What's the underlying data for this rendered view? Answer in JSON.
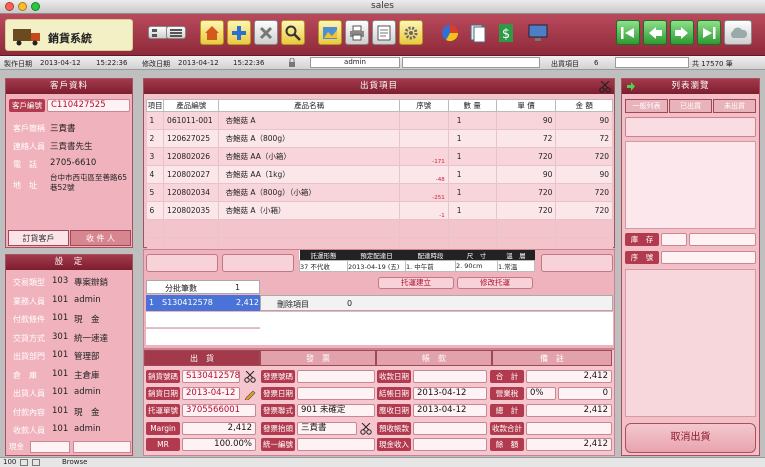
{
  "window": {
    "title": "sales"
  },
  "app": {
    "title": "銷貨系統"
  },
  "status": {
    "made_date_label": "製作日期",
    "made_date": "2013-04-12",
    "made_time": "15:22:36",
    "modified_date_label": "修改日期",
    "modified_date": "2013-04-12",
    "modified_time": "15:22:36",
    "user": "admin",
    "ship_items_label": "出貨項目",
    "ship_items_count": "6",
    "total_label": "共 17570 筆"
  },
  "customer": {
    "header": "客戶資料",
    "code_label": "客戶編號",
    "code": "C110427525",
    "short_label": "客戶簡稱",
    "short": "三貢書",
    "contact_label": "連絡人員",
    "contact": "三貢書先生",
    "phone_label": "電　話",
    "phone": "2705-6610",
    "address_label": "地　址",
    "address": "台中市西屯區至善路65巷52號",
    "tab_order": "訂貨客戶",
    "tab_receive": "收 件 人"
  },
  "settings": {
    "header": "設　定",
    "rows": [
      {
        "label": "交易類型",
        "code": "103",
        "name": "專案辦銷"
      },
      {
        "label": "業務人員",
        "code": "101",
        "name": "admin"
      },
      {
        "label": "付款條件",
        "code": "101",
        "name": "現　金"
      },
      {
        "label": "交貨方式",
        "code": "301",
        "name": "統一速達"
      },
      {
        "label": "出貨部門",
        "code": "101",
        "name": "管理部"
      },
      {
        "label": "倉　庫",
        "code": "101",
        "name": "主倉庫"
      },
      {
        "label": "出貨人員",
        "code": "101",
        "name": "admin"
      },
      {
        "label": "付款內容",
        "code": "101",
        "name": "現　金"
      },
      {
        "label": "收款人員",
        "code": "101",
        "name": "admin"
      }
    ],
    "cash_label": "現金"
  },
  "items": {
    "header": "出貨項目",
    "columns": [
      "項目",
      "產品編號",
      "產品名稱",
      "序號",
      "數 量",
      "單 價",
      "金 額"
    ],
    "rows": [
      {
        "no": "1",
        "code": "061011-001",
        "name": "杏鮑菇 A",
        "serial": "",
        "qty": "1",
        "price": "90",
        "amount": "90"
      },
      {
        "no": "2",
        "code": "120627025",
        "name": "杏鮑菇 A（800g）",
        "serial": "",
        "qty": "1",
        "price": "72",
        "amount": "72"
      },
      {
        "no": "3",
        "code": "120802026",
        "name": "杏鮑菇 AA（小箱）",
        "serial": "-171",
        "qty": "1",
        "price": "720",
        "amount": "720"
      },
      {
        "no": "4",
        "code": "120802027",
        "name": "杏鮑菇 AA（1kg）",
        "serial": "-48",
        "qty": "1",
        "price": "90",
        "amount": "90"
      },
      {
        "no": "5",
        "code": "120802034",
        "name": "杏鮑菇 A（800g）（小箱）",
        "serial": "-251",
        "qty": "1",
        "price": "720",
        "amount": "720"
      },
      {
        "no": "6",
        "code": "120802035",
        "name": "杏鮑菇 A（小箱）",
        "serial": "-1",
        "qty": "1",
        "price": "720",
        "amount": "720"
      }
    ]
  },
  "consign": {
    "columns": [
      "託運形態",
      "預定配達日",
      "配達時段",
      "尺　寸",
      "溫　層"
    ],
    "row": {
      "type": "37 不代收",
      "date": "2013-04-19 (五)",
      "slot": "1. 中午前",
      "size": "2. 90cm",
      "temp": "1.常溫"
    },
    "create_button": "托運建立",
    "modify_button": "修改托運"
  },
  "batch": {
    "count_label": "分批筆數",
    "count": "1",
    "row_no": "1",
    "row_code": "S130412578",
    "row_amount": "2,412",
    "remove_label": "刪除項目",
    "remove_value": "0"
  },
  "bottom": {
    "tabs": [
      "出　貨",
      "發　票",
      "帳　款",
      "備　註"
    ],
    "ship_no_label": "銷貨號碼",
    "ship_no": "S130412578",
    "ship_date_label": "銷貨日期",
    "ship_date": "2013-04-12",
    "consign_no_label": "托運單號",
    "consign_no": "3705566001",
    "margin_label": "Margin",
    "margin": "2,412",
    "mr_label": "MR",
    "mr": "100.00%",
    "inv_no_label": "發票號碼",
    "inv_date_label": "發票日期",
    "inv_type_label": "發票聯式",
    "inv_type": "901 未確定",
    "inv_head_label": "發票抬頭",
    "inv_head": "三貢書",
    "tax_id_label": "統一編號",
    "recv_date_label": "收款日期",
    "close_date_label": "結帳日期",
    "close_date": "2013-04-12",
    "due_date_label": "應收日期",
    "due_date": "2013-04-12",
    "pre_recv_label": "預收帳款",
    "cash_recv_label": "現金收入",
    "subtotal_label": "合　計",
    "subtotal": "2,412",
    "tax_label": "營業稅",
    "tax_rate": "0%",
    "tax": "0",
    "total_label": "總　計",
    "total": "2,412",
    "recv_total_label": "收款合計",
    "balance_label": "餘　額",
    "balance": "2,412"
  },
  "right": {
    "header": "列表瀏覽",
    "tabs": [
      "一般列表",
      "已出貨",
      "未出貨"
    ],
    "stock_label": "庫　存",
    "serial_label": "序　號",
    "cancel_button": "取消出貨"
  },
  "footer": {
    "zoom": "100",
    "mode": "Browse"
  }
}
